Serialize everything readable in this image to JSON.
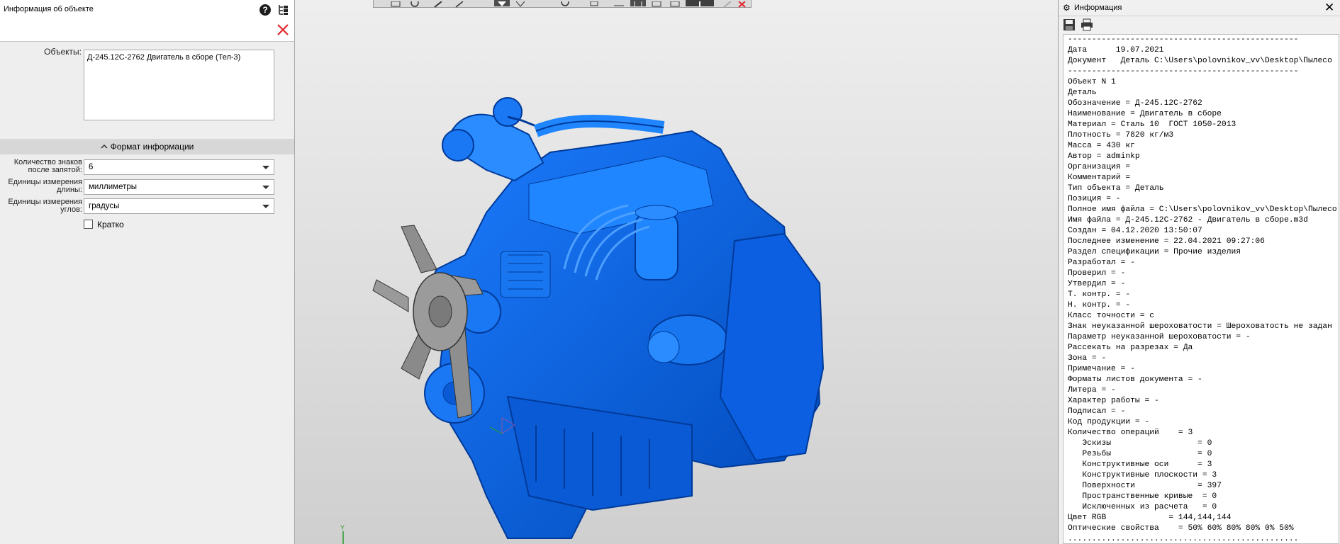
{
  "left_panel": {
    "title": "Информация об объекте",
    "objects_label": "Объекты:",
    "objects_value": "Д-245.12С-2762 Двигатель в сборе (Тел-3)",
    "format_section_title": "Формат информации",
    "decimal_places": {
      "label_line1": "Количество знаков",
      "label_line2": "после запятой:",
      "value": "6"
    },
    "length_units": {
      "label_line1": "Единицы измерения",
      "label_line2": "длины:",
      "value": "миллиметры"
    },
    "angle_units": {
      "label_line1": "Единицы измерения",
      "label_line2": "углов:",
      "value": "градусы"
    },
    "brief_label": "Кратко"
  },
  "viewport": {
    "axis_label": "Y",
    "model_color": "#0a64ee",
    "fan_color": "#8e8e8e"
  },
  "right_panel": {
    "title": "Информация",
    "lines": [
      "------------------------------------------------",
      "Дата      19.07.2021",
      "Документ   Деталь C:\\Users\\polovnikov_vv\\Desktop\\Пылесо",
      "------------------------------------------------",
      "Объект N 1",
      "Деталь",
      "Обозначение = Д-245.12С-2762",
      "Наименование = Двигатель в сборе",
      "Материал = Сталь 10  ГОСТ 1050-2013",
      "Плотность = 7820 кг/м3",
      "Масса = 430 кг",
      "Автор = adminkp",
      "Организация =",
      "Комментарий =",
      "Тип объекта = Деталь",
      "Позиция = -",
      "Полное имя файла = C:\\Users\\polovnikov_vv\\Desktop\\Пылесо",
      "Имя файла = Д-245.12С-2762 - Двигатель в сборе.m3d",
      "Создан = 04.12.2020 13:50:07",
      "Последнее изменение = 22.04.2021 09:27:06",
      "Раздел спецификации = Прочие изделия",
      "Разработал = -",
      "Проверил = -",
      "Утвердил = -",
      "Т. контр. = -",
      "Н. контр. = -",
      "Класс точности = с",
      "Знак неуказанной шероховатости = Шероховатость не задан",
      "Параметр неуказанной шероховатости = -",
      "Рассекать на разрезах = Да",
      "Зона = -",
      "Примечание = -",
      "Форматы листов документа = -",
      "Литера = -",
      "Характер работы = -",
      "Подписал = -",
      "Код продукции = -",
      "Количество операций    = 3",
      "   Эскизы                  = 0",
      "   Резьбы                  = 0",
      "   Конструктивные оси      = 3",
      "   Конструктивные плоскости = 3",
      "   Поверхности             = 397",
      "   Пространственные кривые  = 0",
      "   Исключенных из расчета   = 0",
      "Цвет RGB             = 144,144,144",
      "Оптические свойства    = 50% 60% 80% 80% 0% 50%",
      "................................................"
    ]
  }
}
